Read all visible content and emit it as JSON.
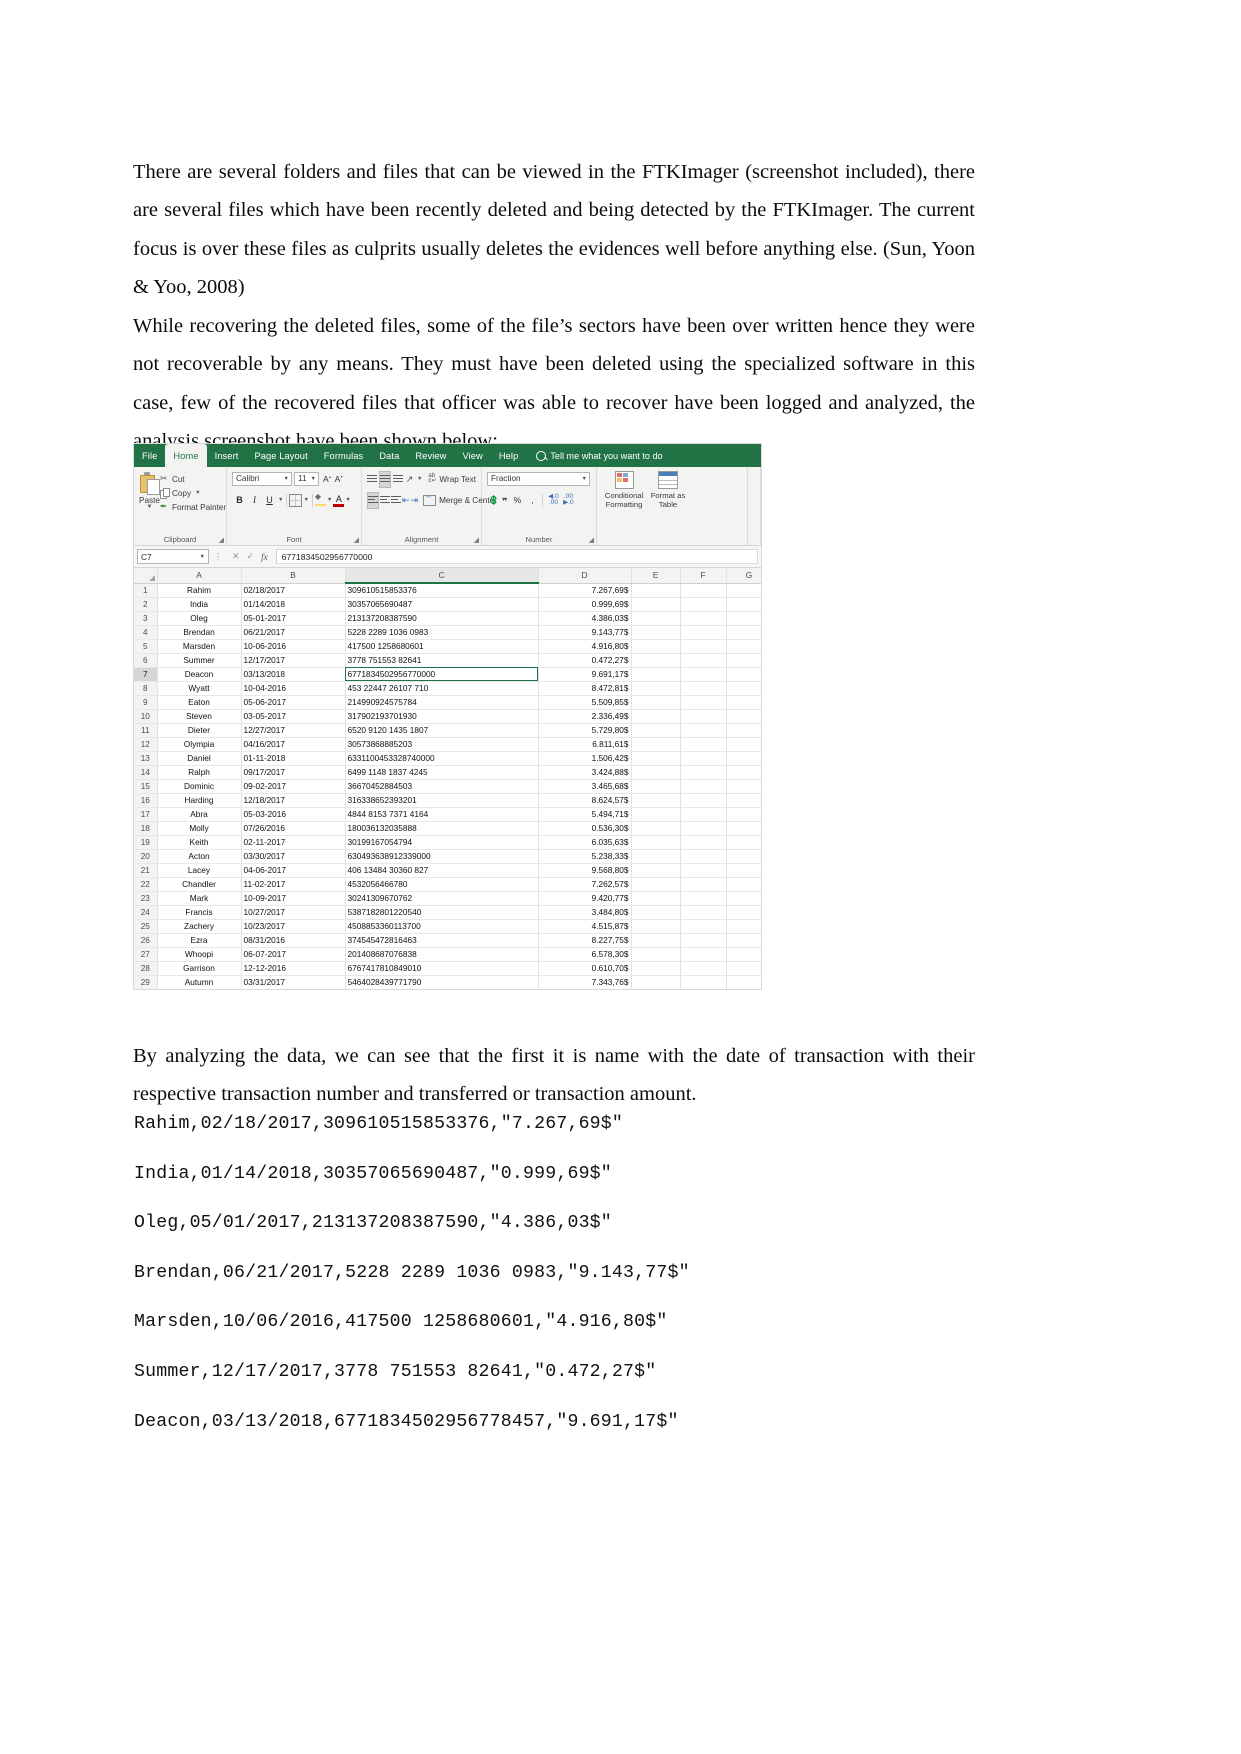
{
  "document": {
    "paragraph_1": "There are several folders and files that can be viewed in the FTKImager (screenshot included), there are several files which have been recently deleted and being detected by the FTKImager. The current focus is over these files as culprits usually deletes the evidences well before anything else. (Sun, Yoon & Yoo, 2008)",
    "paragraph_2": "While recovering the deleted files, some of the file’s sectors have been over written hence they were not recoverable by any means. They must have been deleted using the specialized software in this case, few of the recovered files that officer was able to recover have been logged and analyzed, the analysis screenshot have been shown below:",
    "paragraph_3": "By analyzing the data, we can see that the first it is name with the date of transaction with their respective transaction number and transferred or transaction amount.",
    "csv_lines": [
      "Rahim,02/18/2017,309610515853376,\"7.267,69$\"",
      "India,01/14/2018,30357065690487,\"0.999,69$\"",
      "Oleg,05/01/2017,213137208387590,\"4.386,03$\"",
      "Brendan,06/21/2017,5228 2289 1036 0983,\"9.143,77$\"",
      "Marsden,10/06/2016,417500 1258680601,\"4.916,80$\"",
      "Summer,12/17/2017,3778 751553 82641,\"0.472,27$\"",
      "Deacon,03/13/2018,6771834502956778457,\"9.691,17$\""
    ]
  },
  "excel": {
    "tabs": [
      {
        "label": "File",
        "active": false
      },
      {
        "label": "Home",
        "active": true
      },
      {
        "label": "Insert",
        "active": false
      },
      {
        "label": "Page Layout",
        "active": false
      },
      {
        "label": "Formulas",
        "active": false
      },
      {
        "label": "Data",
        "active": false
      },
      {
        "label": "Review",
        "active": false
      },
      {
        "label": "View",
        "active": false
      },
      {
        "label": "Help",
        "active": false
      }
    ],
    "tell_me": "Tell me what you want to do",
    "ribbon": {
      "clipboard": {
        "group_label": "Clipboard",
        "paste_label": "Paste",
        "cut_label": "Cut",
        "copy_label": "Copy",
        "format_painter_label": "Format Painter"
      },
      "font": {
        "group_label": "Font",
        "font_name": "Calibri",
        "font_size": "11",
        "bold_label": "B",
        "italic_label": "I",
        "underline_label": "U"
      },
      "alignment": {
        "group_label": "Alignment",
        "wrap_text_label": "Wrap Text",
        "merge_center_label": "Merge & Center"
      },
      "number": {
        "group_label": "Number",
        "format_value": "Fraction",
        "percent_label": "%",
        "comma_label": ","
      },
      "styles": {
        "conditional_formatting_label": "Conditional Formatting",
        "format_as_table_label": "Format as Table"
      }
    },
    "formula_bar": {
      "name_box": "C7",
      "formula_value": "6771834502956770000"
    },
    "grid": {
      "column_headers": [
        "A",
        "B",
        "C",
        "D",
        "E",
        "F",
        "G"
      ],
      "selected_cell": "C7",
      "rows": [
        {
          "n": "1",
          "A": "Rahim",
          "B": "02/18/2017",
          "C": "309610515853376",
          "D": "7.267,69$"
        },
        {
          "n": "2",
          "A": "India",
          "B": "01/14/2018",
          "C": "30357065690487",
          "D": "0.999,69$"
        },
        {
          "n": "3",
          "A": "Oleg",
          "B": "05-01-2017",
          "C": "213137208387590",
          "D": "4.386,03$"
        },
        {
          "n": "4",
          "A": "Brendan",
          "B": "06/21/2017",
          "C": "5228 2289 1036 0983",
          "D": "9.143,77$"
        },
        {
          "n": "5",
          "A": "Marsden",
          "B": "10-06-2016",
          "C": "417500 1258680601",
          "D": "4.916,80$"
        },
        {
          "n": "6",
          "A": "Summer",
          "B": "12/17/2017",
          "C": "3778 751553 82641",
          "D": "0.472,27$"
        },
        {
          "n": "7",
          "A": "Deacon",
          "B": "03/13/2018",
          "C": "6771834502956770000",
          "D": "9.691,17$"
        },
        {
          "n": "8",
          "A": "Wyatt",
          "B": "10-04-2016",
          "C": "453 22447 26107 710",
          "D": "8.472,81$"
        },
        {
          "n": "9",
          "A": "Eaton",
          "B": "05-06-2017",
          "C": "214990924575784",
          "D": "5.509,85$"
        },
        {
          "n": "10",
          "A": "Steven",
          "B": "03-05-2017",
          "C": "317902193701930",
          "D": "2.336,49$"
        },
        {
          "n": "11",
          "A": "Dieter",
          "B": "12/27/2017",
          "C": "6520 9120 1435 1807",
          "D": "5.729,80$"
        },
        {
          "n": "12",
          "A": "Olympia",
          "B": "04/16/2017",
          "C": "30573868885203",
          "D": "6.811,61$"
        },
        {
          "n": "13",
          "A": "Daniel",
          "B": "01-11-2018",
          "C": "6331100453328740000",
          "D": "1.506,42$"
        },
        {
          "n": "14",
          "A": "Ralph",
          "B": "09/17/2017",
          "C": "6499 1148 1837 4245",
          "D": "3.424,88$"
        },
        {
          "n": "15",
          "A": "Dominic",
          "B": "09-02-2017",
          "C": "36670452884503",
          "D": "3.465,68$"
        },
        {
          "n": "16",
          "A": "Harding",
          "B": "12/18/2017",
          "C": "316338652393201",
          "D": "8.624,57$"
        },
        {
          "n": "17",
          "A": "Abra",
          "B": "05-03-2016",
          "C": "4844 8153 7371 4164",
          "D": "5.494,71$"
        },
        {
          "n": "18",
          "A": "Molly",
          "B": "07/26/2016",
          "C": "180036132035888",
          "D": "0.536,30$"
        },
        {
          "n": "19",
          "A": "Keith",
          "B": "02-11-2017",
          "C": "30199167054794",
          "D": "6.035,63$"
        },
        {
          "n": "20",
          "A": "Acton",
          "B": "03/30/2017",
          "C": "630493638912339000",
          "D": "5.238,33$"
        },
        {
          "n": "21",
          "A": "Lacey",
          "B": "04-06-2017",
          "C": "406 13484 30360 827",
          "D": "9.568,80$"
        },
        {
          "n": "22",
          "A": "Chandler",
          "B": "11-02-2017",
          "C": "4532056466780",
          "D": "7.262,57$"
        },
        {
          "n": "23",
          "A": "Mark",
          "B": "10-09-2017",
          "C": "30241309670762",
          "D": "9.420,77$"
        },
        {
          "n": "24",
          "A": "Francis",
          "B": "10/27/2017",
          "C": "5387182801220540",
          "D": "3.484,80$"
        },
        {
          "n": "25",
          "A": "Zachery",
          "B": "10/23/2017",
          "C": "4508853360113700",
          "D": "4.515,87$"
        },
        {
          "n": "26",
          "A": "Ezra",
          "B": "08/31/2016",
          "C": "374545472816463",
          "D": "8.227,75$"
        },
        {
          "n": "27",
          "A": "Whoopi",
          "B": "06-07-2017",
          "C": "201408687076838",
          "D": "6.578,30$"
        },
        {
          "n": "28",
          "A": "Garrison",
          "B": "12-12-2016",
          "C": "6767417810849010",
          "D": "0.610,70$"
        },
        {
          "n": "29",
          "A": "Autumn",
          "B": "03/31/2017",
          "C": "5464028439771790",
          "D": "7.343,76$"
        }
      ]
    }
  },
  "colors": {
    "excel_green": "#217346",
    "ribbon_bg": "#f3f3f1",
    "selection_green": "#217346"
  }
}
